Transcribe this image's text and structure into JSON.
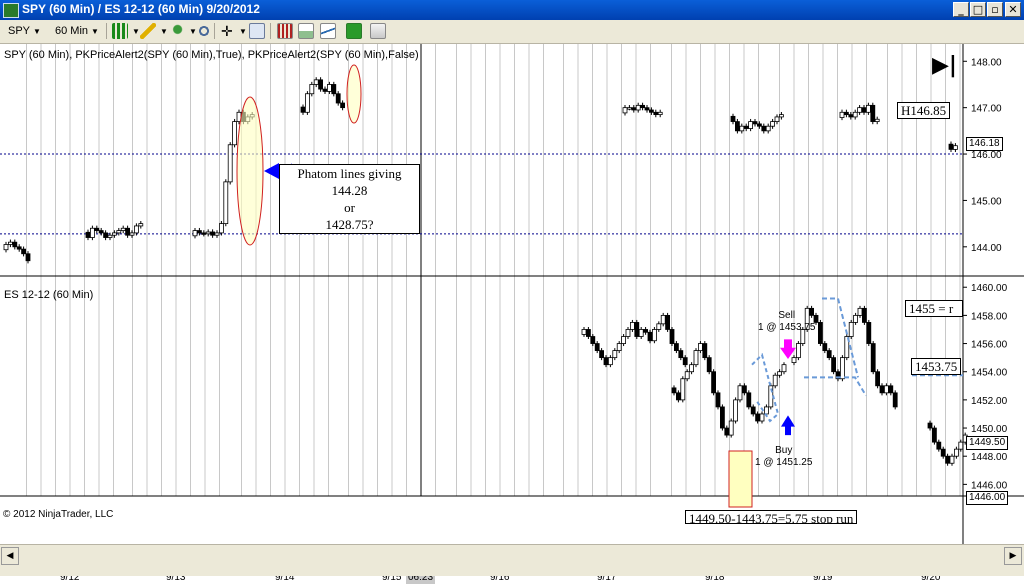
{
  "window": {
    "title": "SPY (60 Min) / ES 12-12 (60 Min)  9/20/2012"
  },
  "toolbar": {
    "instrument": "SPY",
    "interval": "60 Min",
    "icons": [
      "candlestick-icon",
      "pencil-icon",
      "pin-icon",
      "zoom-icon",
      "crosshair-icon",
      "chart-properties-icon",
      "indicators-icon",
      "strategies-icon",
      "data-box-icon",
      "price-marker-icon"
    ]
  },
  "colors": {
    "up_candle": "#ffffff",
    "down_candle": "#000000",
    "grid": "#c8c8c8",
    "dotted_line": "#00008b",
    "highlight": "#ffffc0",
    "ellipse": "#d02020",
    "sell_arrow": "#ff00ff",
    "buy_arrow": "#0000ff",
    "dashed_shape": "#6a9ad8"
  },
  "chart_data": [
    {
      "type": "candlestick",
      "title": "SPY (60 Min), PKPriceAlert2(SPY (60 Min),True), PKPriceAlert2(SPY (60 Min),False)",
      "ylim": [
        143.5,
        148.2
      ],
      "y_ticks": [
        "148.00",
        "147.00",
        "146.00",
        "145.00",
        "144.00"
      ],
      "horizontal_lines": [
        146.0,
        144.28
      ],
      "last_price": "146.18",
      "high_label": "H146.85",
      "annotation": [
        "Phatom lines giving",
        "144.28",
        "or",
        "1428.75?"
      ],
      "segments": [
        {
          "date": "9/12",
          "closes": [
            144.05,
            144.1,
            144.0,
            143.95,
            143.85,
            143.7
          ]
        },
        {
          "date": "9/12-9/13",
          "closes": [
            144.2,
            144.4,
            144.35,
            144.3,
            144.2,
            144.25,
            144.3,
            144.35,
            144.4,
            144.25,
            144.3,
            144.45,
            144.5
          ]
        },
        {
          "date": "9/13",
          "closes": [
            144.35,
            144.3,
            144.28,
            144.32,
            144.25,
            144.3,
            144.5,
            145.4,
            146.2,
            146.7,
            146.9,
            146.7,
            146.8,
            146.85
          ]
        },
        {
          "date": "9/14",
          "closes": [
            146.9,
            147.3,
            147.5,
            147.6,
            147.4,
            147.35,
            147.5,
            147.3,
            147.1,
            147.0
          ]
        },
        {
          "date": "9/17",
          "closes": [
            147.0,
            147.0,
            146.95,
            147.05,
            147.0,
            146.95,
            146.9,
            146.85,
            146.9
          ]
        },
        {
          "date": "9/18",
          "closes": [
            146.7,
            146.5,
            146.6,
            146.55,
            146.7,
            146.65,
            146.6,
            146.5,
            146.6,
            146.7,
            146.8,
            146.85
          ]
        },
        {
          "date": "9/19",
          "closes": [
            146.9,
            146.85,
            146.8,
            146.9,
            147.0,
            146.9,
            147.05,
            146.7,
            146.75
          ]
        },
        {
          "date": "9/20",
          "closes": [
            146.1,
            146.18
          ]
        }
      ]
    },
    {
      "type": "candlestick",
      "title": "ES 12-12 (60 Min)",
      "ylim": [
        1445.6,
        1460.3
      ],
      "y_ticks": [
        "1460.00",
        "1458.00",
        "1456.00",
        "1454.00",
        "1452.00",
        "1450.00",
        "1448.00",
        "1446.00"
      ],
      "last_price": "1449.50",
      "lower_tag": "1446.00",
      "labels": [
        "1455 = r",
        "1453.75",
        "1449.50-1443.75=5.75 stop run"
      ],
      "orders": [
        {
          "side": "Sell",
          "detail": "1 @ 1453.75"
        },
        {
          "side": "Buy",
          "detail": "1 @ 1451.25"
        }
      ],
      "segments": [
        {
          "date": "9/17",
          "closes": [
            1457.0,
            1456.5,
            1456.0,
            1455.5,
            1455.0,
            1454.5,
            1455.0,
            1455.5,
            1456.0,
            1456.5,
            1457.0,
            1457.5,
            1456.5,
            1457.0,
            1456.8,
            1456.2,
            1457.0,
            1457.4,
            1458.0,
            1457.0,
            1456.0,
            1455.5,
            1455.0,
            1454.5
          ]
        },
        {
          "date": "9/18",
          "closes": [
            1452.5,
            1452.0,
            1453.5,
            1454.0,
            1454.5,
            1455.5,
            1456.0,
            1455.0,
            1454.0,
            1452.5,
            1451.5,
            1450.0,
            1449.5,
            1450.5,
            1452.0,
            1453.0,
            1452.5,
            1451.5,
            1451.0,
            1450.5,
            1451.0,
            1451.5,
            1453.0,
            1453.75,
            1454.0,
            1454.5
          ]
        },
        {
          "date": "9/19",
          "closes": [
            1455.0,
            1456.0,
            1457.0,
            1458.5,
            1458.0,
            1457.5,
            1456.0,
            1455.5,
            1455.0,
            1454.0,
            1453.5,
            1455.0,
            1456.5,
            1457.5,
            1458.0,
            1458.5,
            1457.5,
            1456.0,
            1454.0,
            1453.0,
            1452.5,
            1453.0,
            1452.5,
            1451.5
          ]
        },
        {
          "date": "9/20",
          "closes": [
            1450.0,
            1449.0,
            1448.5,
            1448.0,
            1447.5,
            1448.0,
            1448.5,
            1449.0,
            1449.5
          ]
        }
      ]
    }
  ],
  "x_axis": {
    "dates": [
      "9/12",
      "9/13",
      "9/14",
      "9/15",
      "9/16",
      "9/17",
      "9/18",
      "9/19",
      "9/20"
    ],
    "cursor_time": "06:23"
  },
  "footer": {
    "copyright": "© 2012 NinjaTrader, LLC"
  }
}
